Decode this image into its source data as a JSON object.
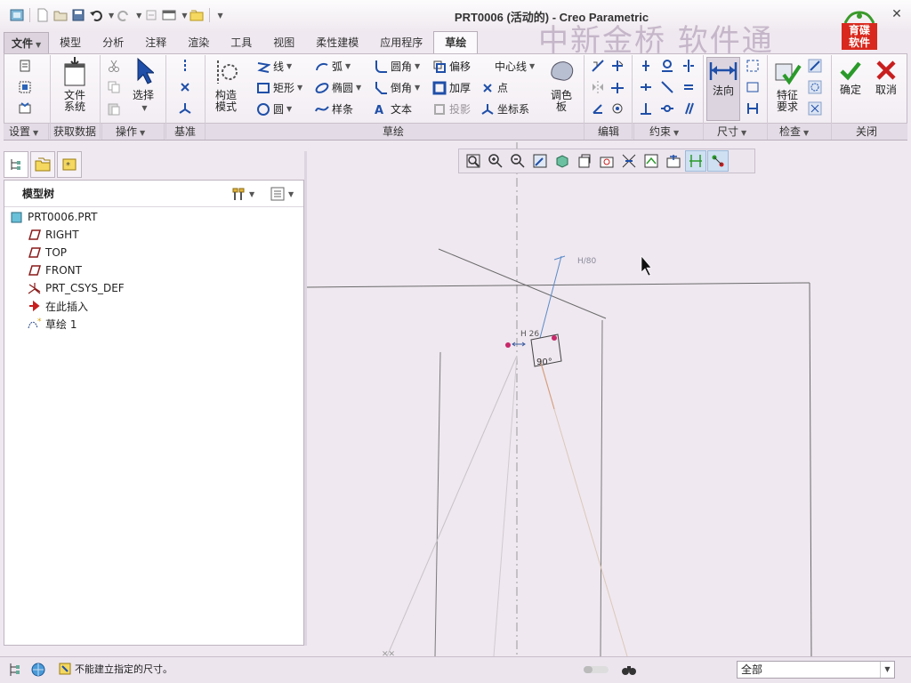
{
  "window": {
    "title": "PRT0006 (活动的) - Creo Parametric",
    "watermark": "中新金桥 软件通",
    "logo_text_1": "育碟",
    "logo_text_2": "软件"
  },
  "ribbon_tabs": [
    "文件",
    "模型",
    "分析",
    "注释",
    "渲染",
    "工具",
    "视图",
    "柔性建模",
    "应用程序",
    "草绘"
  ],
  "active_tab": "草绘",
  "ribbon": {
    "file_system": "文件\n系统",
    "select": "选择",
    "construct_mode": "构造\n模式",
    "line": "线",
    "rectangle": "矩形",
    "circle": "圆",
    "arc": "弧",
    "ellipse": "椭圆",
    "spline": "样条",
    "fillet": "圆角",
    "chamfer": "倒角",
    "text": "文本",
    "offset": "偏移",
    "thicken": "加厚",
    "project": "投影",
    "centerline": "中心线",
    "point": "点",
    "coord_system": "坐标系",
    "palette": "调色\n板",
    "normal": "法向",
    "feature_req": "特征\n要求",
    "ok": "确定",
    "cancel": "取消"
  },
  "groups": {
    "setup": "设置",
    "get_data": "获取数据",
    "operations": "操作",
    "datum": "基准",
    "sketch": "草绘",
    "edit": "编辑",
    "constrain": "约束",
    "dimension": "尺寸",
    "inspect": "检查",
    "close": "关闭"
  },
  "model_tree": {
    "header": "模型树",
    "items": [
      "PRT0006.PRT",
      "RIGHT",
      "TOP",
      "FRONT",
      "PRT_CSYS_DEF",
      "在此插入",
      "草绘 1"
    ]
  },
  "sketch_labels": {
    "angle_top": "H/80",
    "angle_bottom": "90°",
    "small_dim": "H 26"
  },
  "status": {
    "message": "不能建立指定的尺寸。",
    "filter": "全部"
  },
  "colors": {
    "background": "#efe8f0",
    "ok_green": "#2a9a2a",
    "cancel_red": "#c81e1e",
    "accent_blue": "#1f4fa8"
  }
}
